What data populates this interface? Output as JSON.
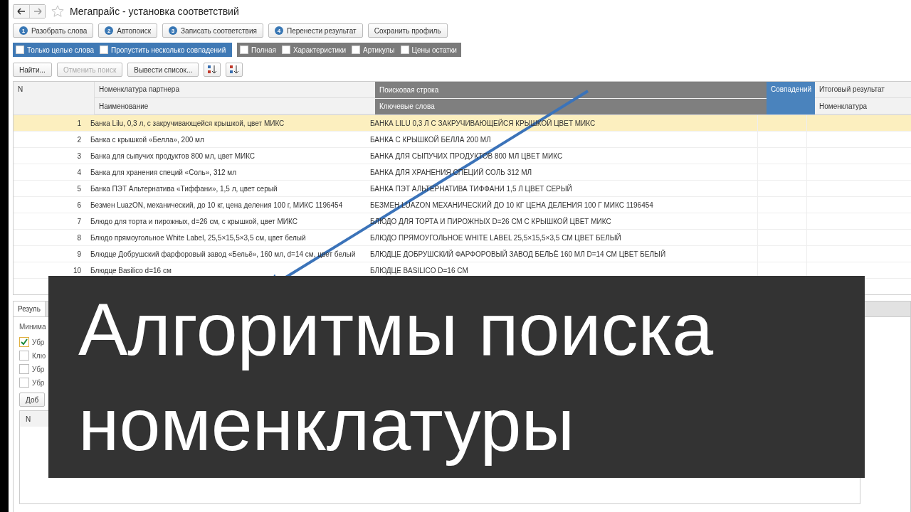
{
  "window": {
    "title": "Мегапрайс - установка соответствий",
    "favorite": false
  },
  "actions": [
    {
      "step": "1",
      "label": "Разобрать слова"
    },
    {
      "step": "2",
      "label": "Автопоиск"
    },
    {
      "step": "3",
      "label": "Записать соответствия"
    },
    {
      "step": "4",
      "label": "Перенести результат"
    },
    {
      "label": "Сохранить профиль"
    }
  ],
  "options_blue": [
    {
      "label": "Только целые слова",
      "checked": false
    },
    {
      "label": "Пропустить несколько совпадений",
      "checked": false
    }
  ],
  "options_gray": [
    {
      "label": "Полная",
      "checked": false
    },
    {
      "label": "Характеристики",
      "checked": false
    },
    {
      "label": "Артикулы",
      "checked": false
    },
    {
      "label": "Цены остатки",
      "checked": false
    }
  ],
  "toolbar": [
    {
      "label": "Найти...",
      "disabled": false
    },
    {
      "label": "Отменить поиск",
      "disabled": true
    },
    {
      "label": "Вывести список...",
      "disabled": false
    }
  ],
  "table": {
    "columns": {
      "n": "N",
      "partner": "Номенклатура партнера",
      "name": "Наименование",
      "search": "Поисковая строка",
      "keywords": "Ключевые слова",
      "matches": "Совпадений",
      "result": "Итоговый результат",
      "nomenclature": "Номенклатура"
    },
    "rows": [
      {
        "n": "1",
        "name": "Банка Lilu, 0,3 л, с закручивающейся крышкой, цвет МИКС",
        "keywords": "БАНКА LILU 0,3 Л С ЗАКРУЧИВАЮЩЕЙСЯ КРЫШКОЙ ЦВЕТ МИКС",
        "selected": true
      },
      {
        "n": "2",
        "name": "Банка с крышкой «Белла», 200 мл",
        "keywords": "БАНКА С КРЫШКОЙ БЕЛЛА 200 МЛ",
        "selected": false
      },
      {
        "n": "3",
        "name": "Банка для сыпучих продуктов 800 мл, цвет МИКС",
        "keywords": "БАНКА ДЛЯ СЫПУЧИХ ПРОДУКТОВ 800 МЛ ЦВЕТ МИКС",
        "selected": false
      },
      {
        "n": "4",
        "name": "Банка для хранения специй «Соль», 312 мл",
        "keywords": "БАНКА ДЛЯ ХРАНЕНИЯ СПЕЦИЙ СОЛЬ 312 МЛ",
        "selected": false
      },
      {
        "n": "5",
        "name": "Банка ПЭТ Альтернатива «Тиффани», 1,5 л, цвет серый",
        "keywords": "БАНКА ПЭТ АЛЬТЕРНАТИВА ТИФФАНИ 1,5 Л ЦВЕТ СЕРЫЙ",
        "selected": false
      },
      {
        "n": "6",
        "name": "Безмен LuazON, механический, до 10 кг, цена деления 100 г, МИКС 1196454",
        "keywords": "БЕЗМЕН LUAZON МЕХАНИЧЕСКИЙ ДО 10 КГ ЦЕНА ДЕЛЕНИЯ 100 Г МИКС 1196454",
        "selected": false
      },
      {
        "n": "7",
        "name": "Блюдо для торта и пирожных, d=26 см, с крышкой, цвет МИКС",
        "keywords": "БЛЮДО ДЛЯ ТОРТА И ПИРОЖНЫХ D=26 СМ С КРЫШКОЙ ЦВЕТ МИКС",
        "selected": false
      },
      {
        "n": "8",
        "name": "Блюдо прямоугольное White Label, 25,5×15,5×3,5 см, цвет белый",
        "keywords": "БЛЮДО ПРЯМОУГОЛЬНОЕ WHITE LABEL 25,5×15,5×3,5 СМ ЦВЕТ БЕЛЫЙ",
        "selected": false
      },
      {
        "n": "9",
        "name": "Блюдце Добрушский фарфоровый завод «Бельё», 160 мл, d=14 см, цвет белый",
        "keywords": "БЛЮДЦЕ ДОБРУШСКИЙ ФАРФОРОВЫЙ ЗАВОД БЕЛЬЁ 160 МЛ D=14 СМ ЦВЕТ БЕЛЫЙ",
        "selected": false
      },
      {
        "n": "10",
        "name": "Блюдце Basilico d=16 см",
        "keywords": "БЛЮДЦЕ BASILICO D=16 СМ",
        "selected": false
      }
    ]
  },
  "lower_panel": {
    "tabs": [
      {
        "label": "Резуль",
        "selected": true
      }
    ],
    "min_length_label": "Минима",
    "checks": [
      {
        "label": "Убр",
        "checked": true
      },
      {
        "label": "Клю",
        "checked": false
      },
      {
        "label": "Убр",
        "checked": false
      },
      {
        "label": "Убр",
        "checked": false
      }
    ],
    "add_button": "Доб",
    "list_column": "N"
  },
  "caption": {
    "lines": [
      "Алгоритмы поиска",
      "номенклатуры"
    ]
  }
}
